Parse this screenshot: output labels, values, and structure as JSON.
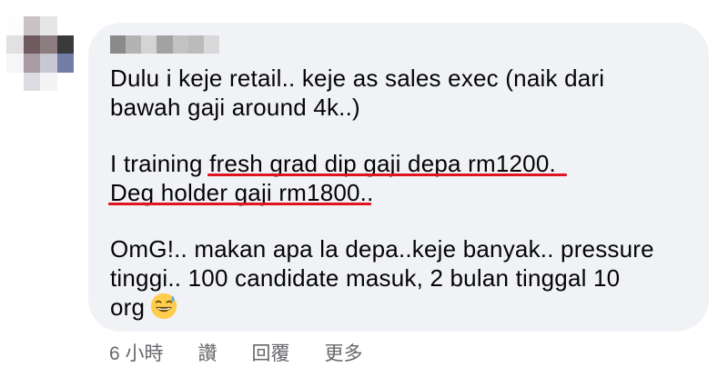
{
  "comment": {
    "paragraphs": [
      {
        "lines": [
          "Dulu i keje retail.. keje as sales exec (naik dari",
          "bawah gaji around 4k..)"
        ]
      },
      {
        "line1_prefix": "I training ",
        "line1_highlight": "fresh grad dip gaji depa rm1200.",
        "line2_highlight": "Deg holder gaji rm1800",
        "line2_suffix": ".."
      },
      {
        "lines": [
          "OmG!.. makan apa la depa..keje banyak.. pressure",
          "tinggi.. 100 candidate masuk, 2 bulan tinggal 10"
        ],
        "last_line": "org"
      }
    ],
    "emoji": "grinning-face-with-sweat-emoji",
    "highlight_color": "#e0141e"
  },
  "actions": {
    "timestamp": "6 小時",
    "like_label": "讚",
    "reply_label": "回覆",
    "more_label": "更多"
  },
  "colors": {
    "bubble": "#f0f2f5",
    "text": "#050505",
    "secondary": "#65676b"
  }
}
